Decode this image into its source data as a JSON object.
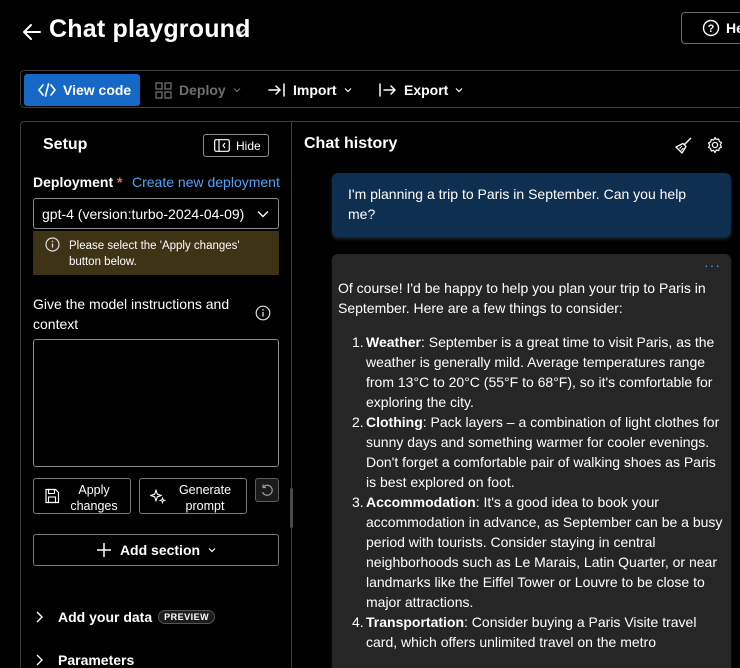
{
  "header": {
    "title": "Chat playground",
    "help_label": "He"
  },
  "toolbar": {
    "view_code": "View code",
    "deploy": "Deploy",
    "import": "Import",
    "export": "Export"
  },
  "setup": {
    "title": "Setup",
    "hide_label": "Hide",
    "deployment_label": "Deployment",
    "required_mark": "*",
    "create_link": "Create new deployment",
    "selected_deployment": "gpt-4 (version:turbo-2024-04-09)",
    "warning": "Please select the 'Apply changes' button below.",
    "instructions_label": "Give the model instructions and context",
    "instructions_value": "",
    "apply_label": "Apply changes",
    "generate_label": "Generate prompt",
    "add_section_label": "Add section",
    "add_data_label": "Add your data",
    "preview_badge": "PREVIEW",
    "parameters_label": "Parameters"
  },
  "chat": {
    "title": "Chat history",
    "user_message": "I'm planning a trip to Paris in September. Can you help me?",
    "more_label": "···",
    "assistant_intro": "Of course! I'd be happy to help you plan your trip to Paris in September. Here are a few things to consider:",
    "assistant_items": [
      {
        "num": "1.",
        "heading": "Weather",
        "text": ": September is a great time to visit Paris, as the weather is generally mild. Average temperatures range from 13°C to 20°C (55°F to 68°F), so it's comfortable for exploring the city."
      },
      {
        "num": "2.",
        "heading": "Clothing",
        "text": ": Pack layers – a combination of light clothes for sunny days and something warmer for cooler evenings. Don't forget a comfortable pair of walking shoes as Paris is best explored on foot."
      },
      {
        "num": "3.",
        "heading": "Accommodation",
        "text": ": It's a good idea to book your accommodation in advance, as September can be a busy period with tourists. Consider staying in central neighborhoods such as Le Marais, Latin Quarter, or near landmarks like the Eiffel Tower or Louvre to be close to major attractions."
      },
      {
        "num": "4.",
        "heading": "Transportation",
        "text": ": Consider buying a Paris Visite travel card, which offers unlimited travel on the metro"
      }
    ]
  },
  "colors": {
    "accent": "#1668c7",
    "link": "#4fa3f7",
    "user_bubble": "#0e2f4f",
    "assistant_bubble": "#262626",
    "warning_bg": "#3f3316"
  }
}
